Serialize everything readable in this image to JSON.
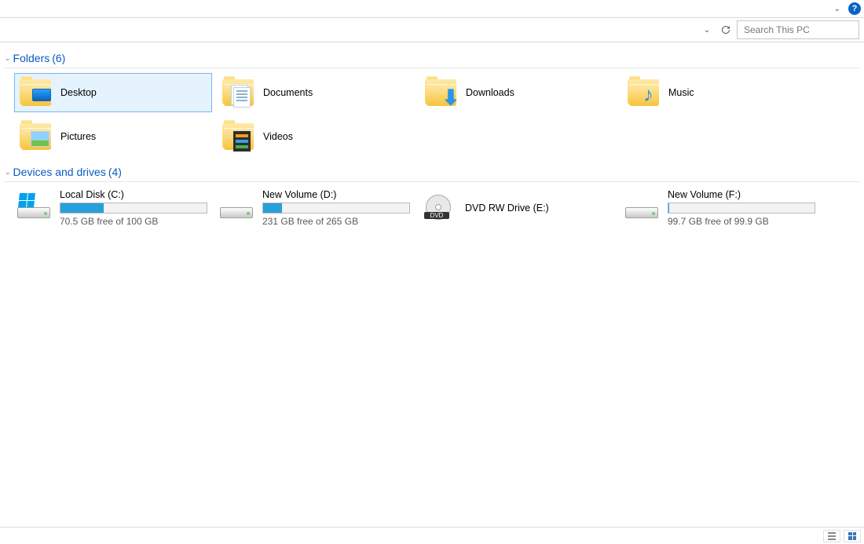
{
  "search": {
    "placeholder": "Search This PC"
  },
  "groups": {
    "folders": {
      "title": "Folders",
      "count": "(6)",
      "items": [
        {
          "name": "Desktop",
          "icon": "desktop",
          "selected": true
        },
        {
          "name": "Documents",
          "icon": "documents",
          "selected": false
        },
        {
          "name": "Downloads",
          "icon": "downloads",
          "selected": false
        },
        {
          "name": "Music",
          "icon": "music",
          "selected": false
        },
        {
          "name": "Pictures",
          "icon": "pictures",
          "selected": false
        },
        {
          "name": "Videos",
          "icon": "videos",
          "selected": false
        }
      ]
    },
    "drives": {
      "title": "Devices and drives",
      "count": "(4)",
      "items": [
        {
          "name": "Local Disk (C:)",
          "icon": "sysdrive",
          "free": "70.5 GB free of 100 GB",
          "fill_pct": 29.5
        },
        {
          "name": "New Volume (D:)",
          "icon": "hdd",
          "free": "231 GB free of 265 GB",
          "fill_pct": 12.8
        },
        {
          "name": "DVD RW Drive (E:)",
          "icon": "dvd",
          "free": null,
          "fill_pct": null
        },
        {
          "name": "New Volume (F:)",
          "icon": "hdd",
          "free": "99.7 GB free of 99.9 GB",
          "fill_pct": 0.2
        }
      ]
    }
  }
}
